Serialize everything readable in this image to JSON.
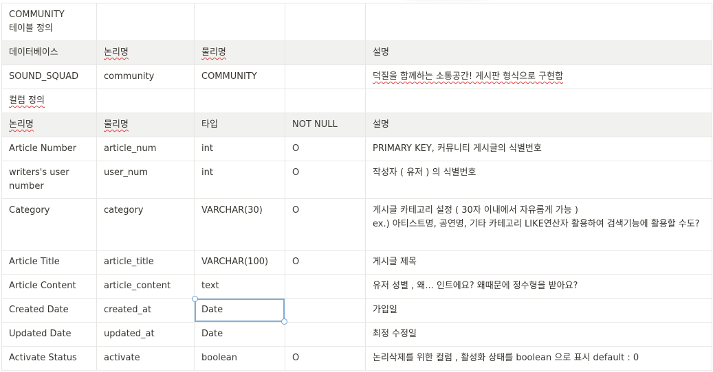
{
  "table": {
    "title": "COMMUNITY\n테이블 정의",
    "meta_headers": [
      "데이터베이스",
      "논리명",
      "물리명",
      "",
      "설명"
    ],
    "meta_row": [
      "SOUND_SQUAD",
      "community",
      "COMMUNITY",
      "",
      "덕질을 함께하는 소통공간! 게시판 형식으로 구현함"
    ],
    "column_section_label": "컬럼 정의",
    "column_headers": [
      "논리명",
      "물리명",
      "타입",
      "NOT NULL",
      "설명"
    ],
    "rows": [
      [
        "Article Number",
        "article_num",
        "int",
        "O",
        "PRIMARY KEY, 커뮤니티 게시글의 식별번호"
      ],
      [
        "writers's user number",
        "user_num",
        "int",
        "O",
        "작성자 ( 유저 ) 의 식별번호"
      ],
      [
        "Category",
        "category",
        "VARCHAR(30)",
        "O",
        "게시글 카테고리 설정 ( 30자 이내에서 자유롭게 가능 )\nex.) 아티스트명, 공연명, 기타 카테고리 LIKE연산자 활용하여 검색기능에 활용할 수도?"
      ],
      [
        "Article Title",
        "article_title",
        "VARCHAR(100)",
        "O",
        "게시글 제목"
      ],
      [
        "Article Content",
        "article_content",
        "text",
        "",
        "유저 성별 , 왜... 인트에요? 왜때문에 정수형을 받아요?"
      ],
      [
        "Created Date",
        "created_at",
        "Date",
        "",
        "가입일"
      ],
      [
        "Updated Date",
        "updated_at",
        "Date",
        "",
        "최정 수정일"
      ],
      [
        "Activate Status",
        "activate",
        "boolean",
        "O",
        "논리삭제를 위한 컬럼 , 활성화 상태를 boolean 으로 표시 default : 0"
      ]
    ]
  },
  "selection": {
    "row": 5,
    "column": 2
  },
  "colors": {
    "header_bg": "#f1f1ef",
    "border": "#e7e6e4",
    "selection": "#7fb0dc",
    "spellcheck": "#e03e3e",
    "text": "#37352f"
  }
}
